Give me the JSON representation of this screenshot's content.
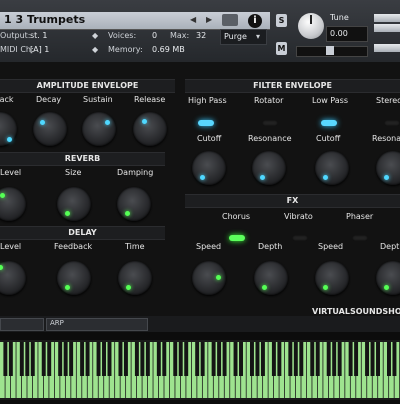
{
  "header": {
    "instrument_title": "1 3 Trumpets",
    "output_label": "Output:",
    "output_value": "st. 1",
    "midi_label": "MIDI Ch:",
    "midi_value": "[A] 1",
    "voices_label": "Voices:",
    "voices_value": "0",
    "max_label": "Max:",
    "max_value": "32",
    "memory_label": "Memory:",
    "memory_value": "0.69 MB",
    "purge_label": "Purge",
    "solo_label": "S",
    "mute_label": "M",
    "info_label": "i",
    "tune_label": "Tune",
    "tune_value": "0.00"
  },
  "amplitude": {
    "title": "AMPLITUDE ENVELOPE",
    "knobs": [
      "Attack",
      "Decay",
      "Sustain",
      "Release"
    ]
  },
  "filter_env": {
    "title": "FILTER ENVELOPE",
    "toggles": [
      "High Pass",
      "Rotator",
      "Low Pass",
      "Stereo"
    ],
    "knobs": [
      "Cutoff",
      "Resonance",
      "Cutoff",
      "Resonance"
    ]
  },
  "reverb": {
    "title": "REVERB",
    "knobs": [
      "Level",
      "Size",
      "Damping"
    ]
  },
  "delay": {
    "title": "DELAY",
    "knobs": [
      "Level",
      "Feedback",
      "Time"
    ]
  },
  "fx": {
    "title": "FX",
    "toggles": [
      "Chorus",
      "Vibrato",
      "Phaser"
    ],
    "knobs": [
      "Speed",
      "Depth",
      "Speed",
      "Depth"
    ]
  },
  "brand": "VIRTUALSOUNDSHOP",
  "footer": {
    "arp_label": "ARP"
  },
  "colors": {
    "accent_cyan": "#4fd8ff",
    "accent_green": "#55ff55",
    "keyboard_white": "#9ee38f"
  }
}
